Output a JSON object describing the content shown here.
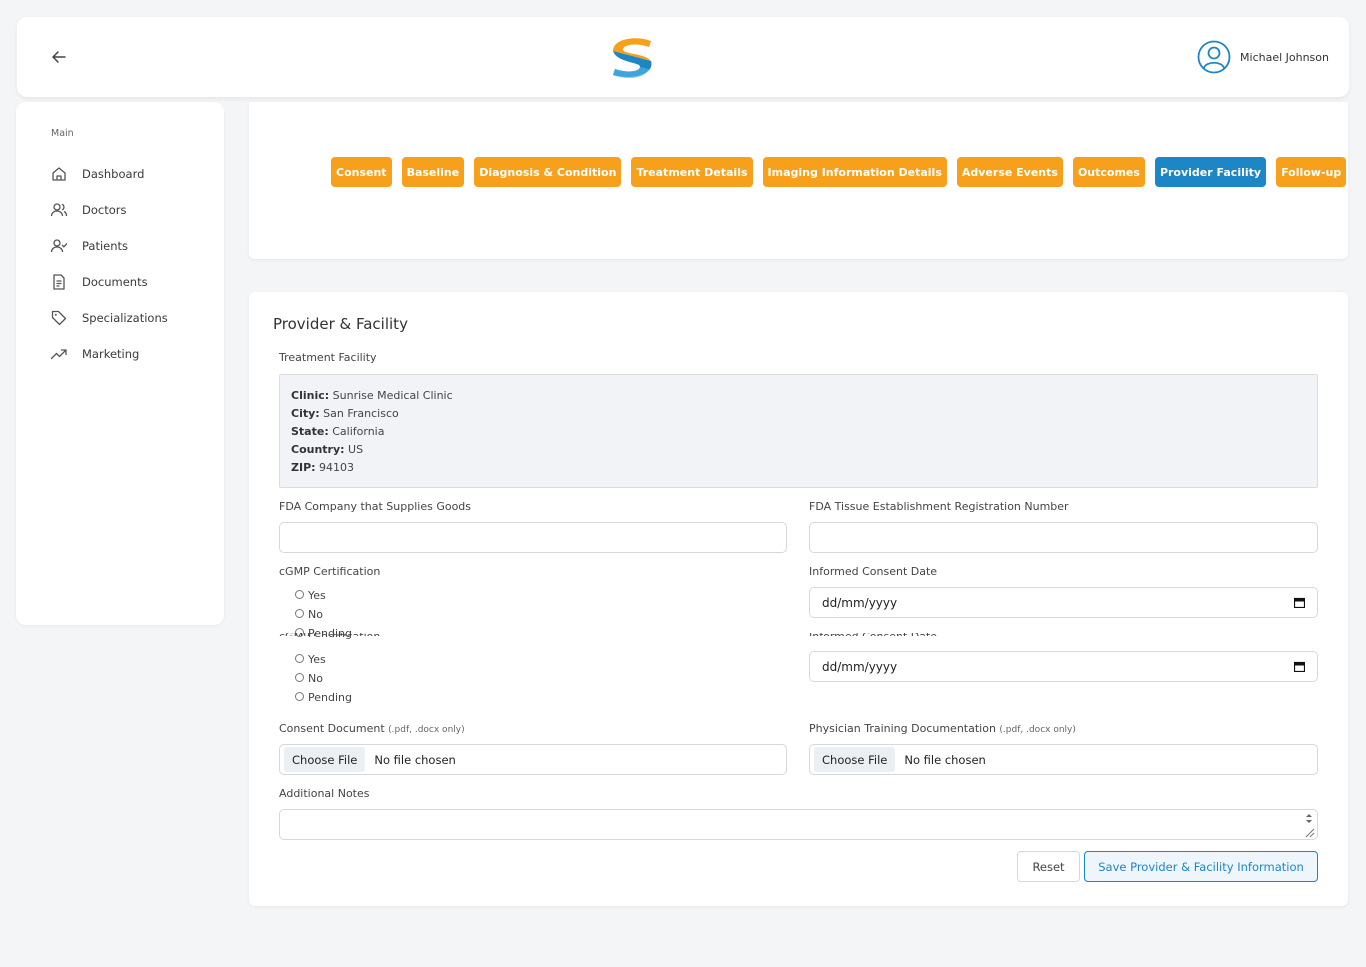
{
  "header": {
    "back_icon": "arrow-left-icon",
    "logo": "S-logo",
    "user_name": "Michael Johnson",
    "user_icon": "user-circle-icon",
    "accent": "#1d86c4",
    "brand_orange": "#f6a01b"
  },
  "sidebar": {
    "section": "Main",
    "items": [
      {
        "label": "Dashboard",
        "icon": "home-icon"
      },
      {
        "label": "Doctors",
        "icon": "users-icon"
      },
      {
        "label": "Patients",
        "icon": "user-check-icon"
      },
      {
        "label": "Documents",
        "icon": "document-icon"
      },
      {
        "label": "Specializations",
        "icon": "tag-icon"
      },
      {
        "label": "Marketing",
        "icon": "trending-up-icon"
      }
    ]
  },
  "tabs": [
    {
      "label": "Consent",
      "active": false
    },
    {
      "label": "Baseline",
      "active": false
    },
    {
      "label": "Diagnosis & Condition",
      "active": false
    },
    {
      "label": "Treatment Details",
      "active": false
    },
    {
      "label": "Imaging Information Details",
      "active": false
    },
    {
      "label": "Adverse Events",
      "active": false
    },
    {
      "label": "Outcomes",
      "active": false
    },
    {
      "label": "Provider Facility",
      "active": true
    },
    {
      "label": "Follow-up",
      "active": false
    }
  ],
  "form": {
    "title": "Provider & Facility",
    "facility_label": "Treatment Facility",
    "facility": {
      "clinic_key": "Clinic:",
      "clinic": "Sunrise Medical Clinic",
      "city_key": "City:",
      "city": "San Francisco",
      "state_key": "State:",
      "state": "California",
      "country_key": "Country:",
      "country": "US",
      "zip_key": "ZIP:",
      "zip": "94103"
    },
    "fda_company_label": "FDA Company that Supplies Goods",
    "fda_company_value": "",
    "fda_tissue_label": "FDA Tissue Establishment Registration Number",
    "fda_tissue_value": "",
    "cgmp_label": "cGMP Certification",
    "cgmp_options": [
      "Yes",
      "No",
      "Pending"
    ],
    "consent_date_label": "Informed Consent Date",
    "date_placeholder": "dd/mm/yyyy",
    "consent_doc_label": "Consent Document",
    "consent_doc_hint": "(.pdf, .docx only)",
    "physician_doc_label": "Physician Training Documentation",
    "physician_doc_hint": "(.pdf, .docx only)",
    "choose_file": "Choose File",
    "no_file": "No file chosen",
    "notes_label": "Additional Notes",
    "notes_value": "",
    "reset_label": "Reset",
    "save_label": "Save Provider & Facility Information"
  }
}
